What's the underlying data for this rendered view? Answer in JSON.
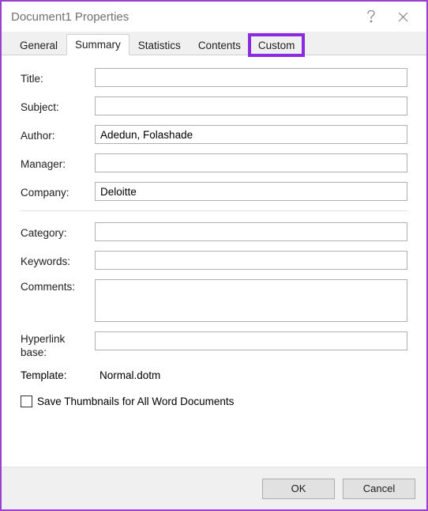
{
  "titlebar": {
    "title": "Document1 Properties"
  },
  "tabs": {
    "general": "General",
    "summary": "Summary",
    "statistics": "Statistics",
    "contents": "Contents",
    "custom": "Custom"
  },
  "fields": {
    "title_label": "Title:",
    "title_value": "",
    "subject_label": "Subject:",
    "subject_value": "",
    "author_label": "Author:",
    "author_value": "Adedun, Folashade",
    "manager_label": "Manager:",
    "manager_value": "",
    "company_label": "Company:",
    "company_value": "Deloitte",
    "category_label": "Category:",
    "category_value": "",
    "keywords_label": "Keywords:",
    "keywords_value": "",
    "comments_label": "Comments:",
    "comments_value": "",
    "hyperlink_label": "Hyperlink\nbase:",
    "hyperlink_value": "",
    "template_label": "Template:",
    "template_value": "Normal.dotm"
  },
  "checkbox": {
    "label": "Save Thumbnails for All Word Documents",
    "checked": false
  },
  "buttons": {
    "ok": "OK",
    "cancel": "Cancel"
  }
}
